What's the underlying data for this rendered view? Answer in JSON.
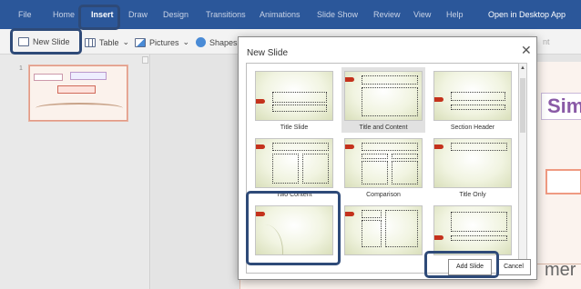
{
  "menubar": {
    "tabs": [
      "File",
      "Home",
      "Insert",
      "Draw",
      "Design",
      "Transitions",
      "Animations",
      "Slide Show",
      "Review",
      "View",
      "Help",
      "Open in Desktop App"
    ],
    "active_tab": "Insert"
  },
  "ribbon": {
    "new_slide": "New Slide",
    "table": "Table",
    "pictures": "Pictures",
    "shapes": "Shapes",
    "truncated_right": "nt"
  },
  "thumbnails": {
    "slide_number": "1"
  },
  "canvas": {
    "title_fragment": "Sim",
    "subtitle_fragment": "mer"
  },
  "dialog": {
    "title": "New Slide",
    "close_glyph": "✕",
    "layouts": [
      {
        "label": "Title Slide",
        "selected": false
      },
      {
        "label": "Title and Content",
        "selected": true
      },
      {
        "label": "Section Header",
        "selected": false
      },
      {
        "label": "Two Content",
        "selected": false
      },
      {
        "label": "Comparison",
        "selected": false
      },
      {
        "label": "Title Only",
        "selected": false
      },
      {
        "label": "",
        "selected": false
      },
      {
        "label": "",
        "selected": false
      },
      {
        "label": "",
        "selected": false
      }
    ],
    "add_button": "Add Slide",
    "cancel_button": "Cancel"
  },
  "colors": {
    "menubar_bg": "#2b579a",
    "callout": "#2e4a78",
    "slide_accent": "#c4321c"
  }
}
